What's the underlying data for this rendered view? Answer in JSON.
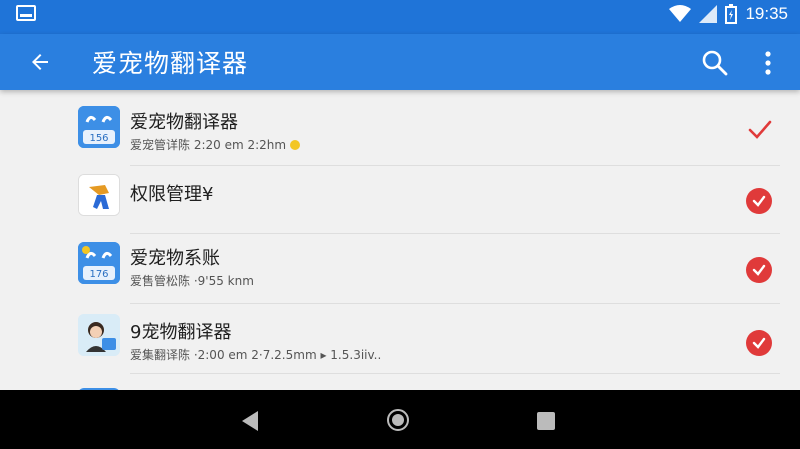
{
  "status_bar": {
    "time": "19:35",
    "icons": [
      "notification-icon",
      "wifi-icon",
      "signal-icon",
      "battery-icon"
    ]
  },
  "app_bar": {
    "title": "爱宠物翻译器",
    "icons": [
      "back-arrow-icon",
      "search-icon",
      "more-vert-icon"
    ]
  },
  "items": [
    {
      "title": "爱宠物翻译器",
      "subtitle": "爱宠管详陈 2:20 em 2:2hm",
      "status": "check"
    },
    {
      "title": "权限管理¥",
      "subtitle": "",
      "status": "checked"
    },
    {
      "title": "爱宠物系账",
      "subtitle": "爱售管松陈 ·9'55 knm",
      "status": "checked"
    },
    {
      "title": "9宠物翻译器",
      "subtitle": "爱集翻译陈 ·2:00 em 2·7.2.5mm ▸ 1.5.3iiv..",
      "status": "checked"
    }
  ],
  "colors": {
    "status_bar": "#1f74d8",
    "app_bar": "#2a7fdf",
    "check_red": "#e03a3a",
    "background": "#f1f1f1"
  },
  "nav_bar": {
    "icons": [
      "nav-back-icon",
      "nav-home-icon",
      "nav-recents-icon"
    ]
  }
}
